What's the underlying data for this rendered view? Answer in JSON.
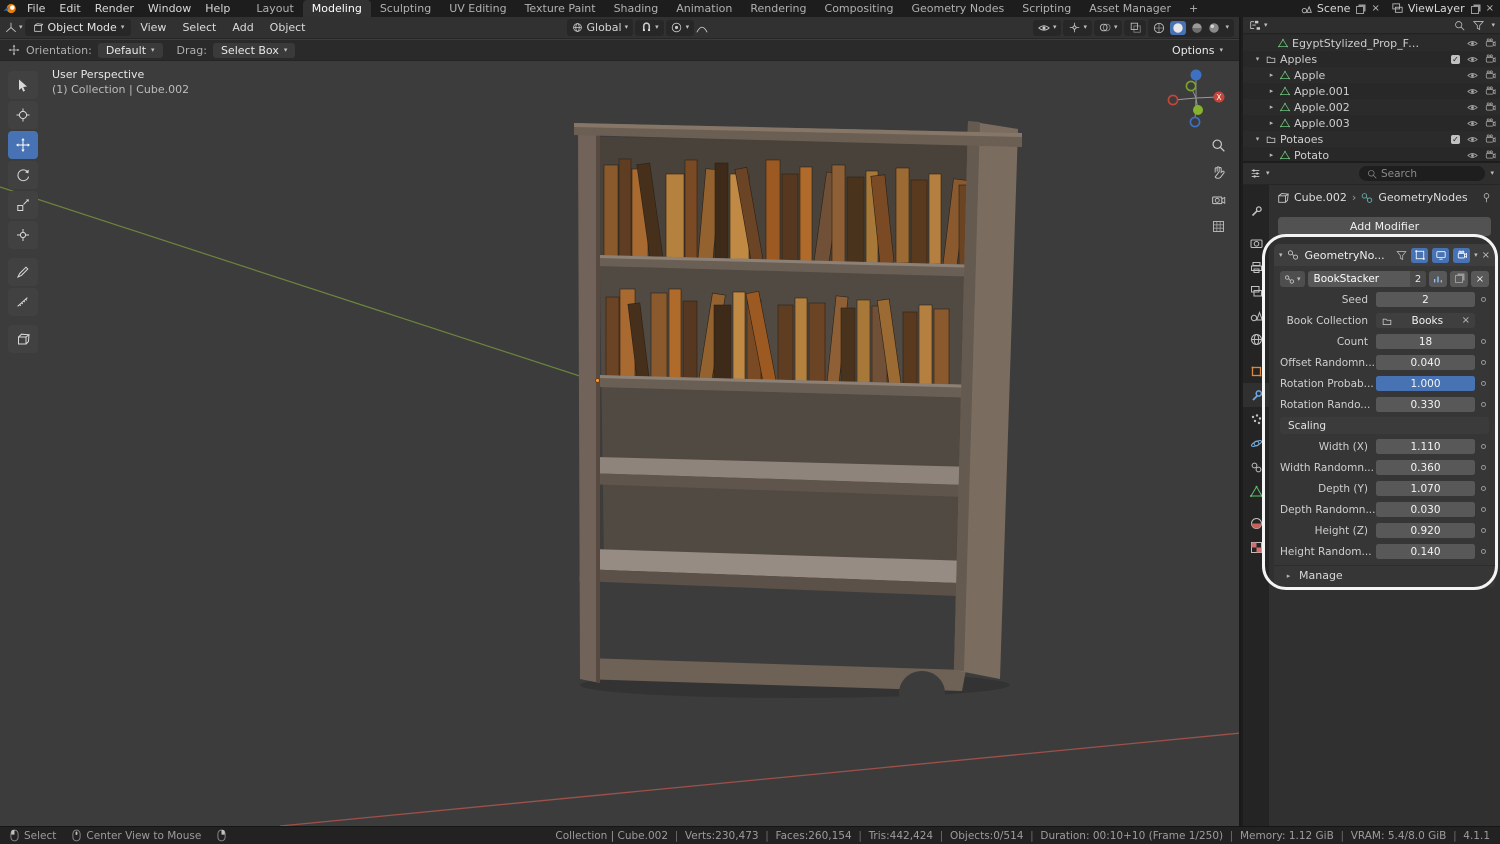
{
  "topbar": {
    "menus": [
      "File",
      "Edit",
      "Render",
      "Window",
      "Help"
    ],
    "workspaces": [
      "Layout",
      "Modeling",
      "Sculpting",
      "UV Editing",
      "Texture Paint",
      "Shading",
      "Animation",
      "Rendering",
      "Compositing",
      "Geometry Nodes",
      "Scripting",
      "Asset Manager"
    ],
    "add_tab": "+",
    "scene_name": "Scene",
    "view_layer_name": "ViewLayer"
  },
  "viewport": {
    "mode": "Object Mode",
    "menus": [
      "View",
      "Select",
      "Add",
      "Object"
    ],
    "orientation": "Global",
    "tool_settings": {
      "orientation_label": "Orientation:",
      "orientation_value": "Default",
      "drag_label": "Drag:",
      "drag_value": "Select Box",
      "options_label": "Options"
    },
    "overlay": {
      "view_name": "User Perspective",
      "context": "(1) Collection | Cube.002"
    },
    "gizmo_x_label": "X"
  },
  "outliner": {
    "rows": [
      {
        "label": "EgyptStylized_Prop_FruitPa"
      },
      {
        "label": "Apples"
      },
      {
        "label": "Apple"
      },
      {
        "label": "Apple.001"
      },
      {
        "label": "Apple.002"
      },
      {
        "label": "Apple.003"
      },
      {
        "label": "Potaoes"
      },
      {
        "label": "Potato"
      }
    ]
  },
  "properties": {
    "search_placeholder": "Search",
    "breadcrumb": {
      "object": "Cube.002",
      "separator": "›",
      "modifier": "GeometryNodes"
    },
    "add_modifier_label": "Add Modifier",
    "modifier": {
      "name": "GeometryNo...",
      "node_group": "BookStacker",
      "node_group_users": "2",
      "params": [
        {
          "label": "Seed",
          "value": "2"
        },
        {
          "label": "Book Collection",
          "value": "Books"
        },
        {
          "label": "Count",
          "value": "18"
        },
        {
          "label": "Offset Randomn...",
          "value": "0.040"
        },
        {
          "label": "Rotation Probab...",
          "value": "1.000"
        },
        {
          "label": "Rotation Rando...",
          "value": "0.330"
        }
      ],
      "scaling_label": "Scaling",
      "scaling_params": [
        {
          "label": "Width (X)",
          "value": "1.110"
        },
        {
          "label": "Width Randomn...",
          "value": "0.360"
        },
        {
          "label": "Depth (Y)",
          "value": "1.070"
        },
        {
          "label": "Depth Randomn...",
          "value": "0.030"
        },
        {
          "label": "Height (Z)",
          "value": "0.920"
        },
        {
          "label": "Height Random...",
          "value": "0.140"
        }
      ],
      "manage_label": "Manage"
    }
  },
  "statusbar": {
    "hints": [
      {
        "label": "Select"
      },
      {
        "label": "Center View to Mouse"
      }
    ],
    "stats": [
      "Collection | Cube.002",
      "Verts:230,473",
      "Faces:260,154",
      "Tris:442,424",
      "Objects:0/514",
      "Duration: 00:10+10 (Frame 1/250)",
      "Memory: 1.12 GiB",
      "VRAM: 5.4/8.0 GiB",
      "4.1.1"
    ]
  }
}
